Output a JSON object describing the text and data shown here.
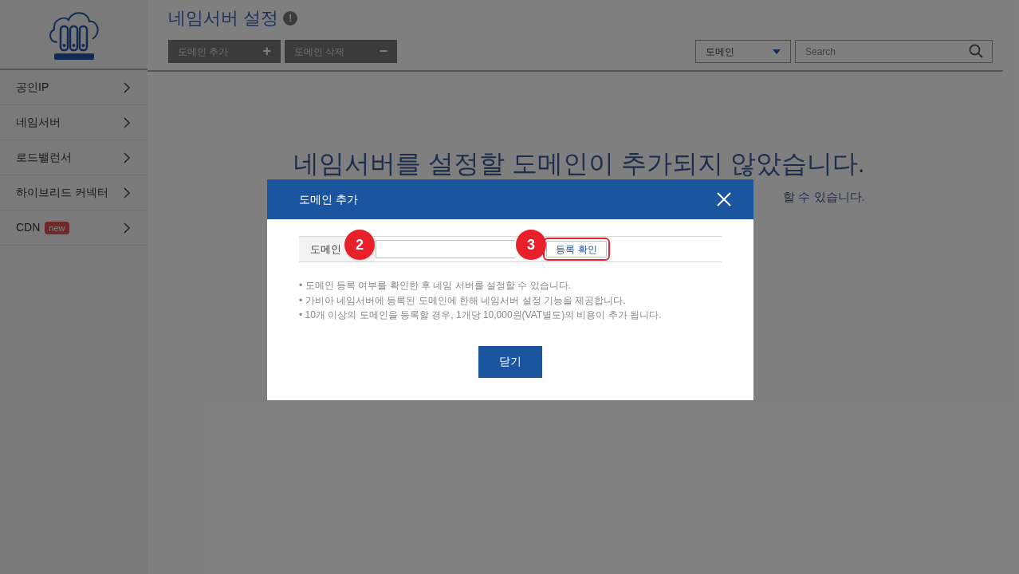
{
  "sidebar": {
    "items": [
      {
        "label": "공인IP"
      },
      {
        "label": "네임서버"
      },
      {
        "label": "로드밸런서"
      },
      {
        "label": "하이브리드 커넥터"
      },
      {
        "label": "CDN",
        "badge": "new"
      }
    ]
  },
  "header": {
    "title": "네임서버 설정",
    "info_icon": "!",
    "buttons": [
      {
        "label": "도메인 추가",
        "icon": "+"
      },
      {
        "label": "도메인 삭제",
        "icon": "−"
      }
    ],
    "filter": {
      "value": "도메인"
    },
    "search": {
      "placeholder": "Search"
    }
  },
  "empty_state": {
    "heading": "네임서버를 설정할 도메인이 추가되지 않았습니다.",
    "subtext": "할 수 있습니다."
  },
  "dialog": {
    "title": "도메인 추가",
    "form": {
      "label": "도메인",
      "check_button": {
        "label": "등록 확인",
        "highlighted": true
      }
    },
    "notes": [
      "• 도메인 등록 여부를 확인한 후 네임 서버를 설정할 수 있습니다.",
      "• 가비아 네임서버에 등록된 도메인에 한해 네임서버 설정 기능을 제공합니다.",
      "• 10개 이상의 도메인을 등록할 경우, 1개당 10,000원(VAT별도)의 비용이 추가 됩니다."
    ],
    "close_button": "닫기"
  },
  "annotations": [
    {
      "kind": "field",
      "label": "2"
    },
    {
      "kind": "button",
      "label": "3"
    }
  ]
}
